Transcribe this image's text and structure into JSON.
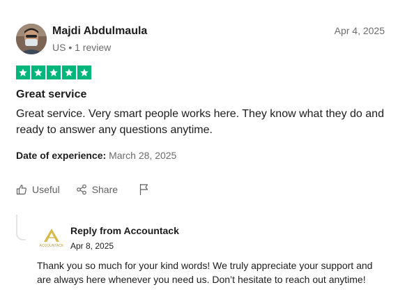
{
  "review": {
    "author_name": "Majdi Abdulmaula",
    "author_meta": "US • 1 review",
    "published_date": "Apr 4, 2025",
    "rating": 5,
    "rating_max": 5,
    "star_color": "#00b67a",
    "title": "Great service",
    "body": "Great service. Very smart people works here. They know what they do and ready to answer any questions anytime.",
    "experience_label": "Date of experience:",
    "experience_date": "March 28, 2025"
  },
  "actions": {
    "useful_label": "Useful",
    "share_label": "Share",
    "icons": [
      "thumbs-up-icon",
      "share-icon",
      "flag-icon"
    ]
  },
  "reply": {
    "header": "Reply from Accountack",
    "date": "Apr 8, 2025",
    "logo_text": "ACCOUNTACK",
    "body": "Thank you so much for your kind words! We truly appreciate your support and are always here whenever you need us. Don’t hesitate to reach out anytime!"
  }
}
